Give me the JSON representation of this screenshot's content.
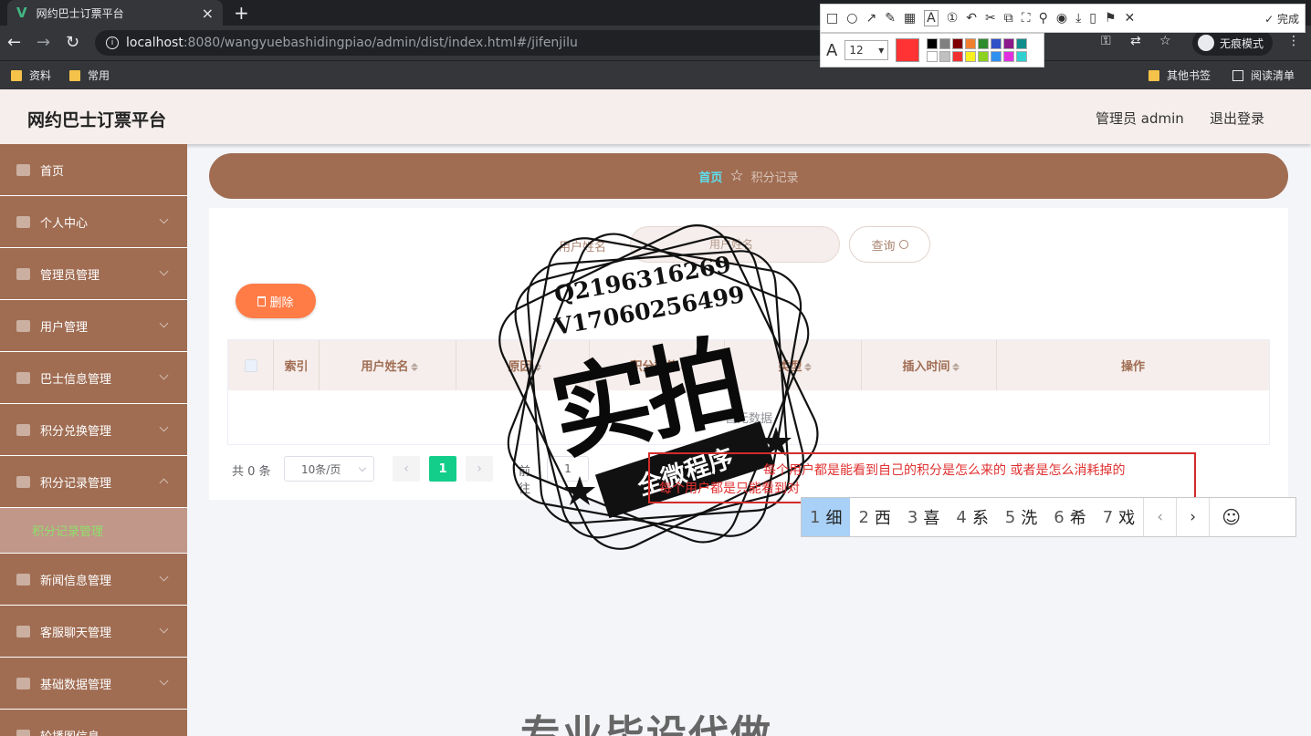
{
  "browser": {
    "tab_title": "网约巴士订票平台",
    "url_host": "localhost",
    "url_path": ":8080/wangyuebashidingpiao/admin/dist/index.html#/jifenjilu",
    "incognito_label": "无痕模式",
    "bookmarks": [
      "资料",
      "常用"
    ],
    "bookmarks_right": [
      "其他书签",
      "阅读清单"
    ]
  },
  "screenshot_tool": {
    "done_label": "完成",
    "font_size": "12",
    "current_color": "#ff3333"
  },
  "header": {
    "title": "网约巴士订票平台",
    "user": "管理员 admin",
    "logout": "退出登录"
  },
  "sidebar": {
    "items": [
      {
        "label": "首页"
      },
      {
        "label": "个人中心"
      },
      {
        "label": "管理员管理"
      },
      {
        "label": "用户管理"
      },
      {
        "label": "巴士信息管理"
      },
      {
        "label": "积分兑换管理"
      },
      {
        "label": "积分记录管理"
      },
      {
        "label": "新闻信息管理"
      },
      {
        "label": "客服聊天管理"
      },
      {
        "label": "基础数据管理"
      },
      {
        "label": "轮播图信息"
      }
    ],
    "sub_item": "积分记录管理"
  },
  "breadcrumb": {
    "home": "首页",
    "current": "积分记录"
  },
  "search": {
    "label": "用户姓名",
    "placeholder": "用户姓名",
    "query_button": "查询"
  },
  "actions": {
    "delete_button": "删除"
  },
  "table": {
    "columns": [
      "索引",
      "用户姓名",
      "原因",
      "积分数值",
      "类型",
      "插入时间",
      "操作"
    ],
    "empty_text": "暂无数据"
  },
  "pagination": {
    "total": "共 0 条",
    "page_size": "10条/页",
    "current_page": "1",
    "goto_label": "前往",
    "goto_value": "1"
  },
  "annotation": {
    "line1": "每个用户都是能看到自己的积分是怎么来的 或者是怎么消耗掉的",
    "line2": "每个用户都是只能看到对"
  },
  "ime": {
    "candidates": [
      {
        "n": "1",
        "c": "细"
      },
      {
        "n": "2",
        "c": "西"
      },
      {
        "n": "3",
        "c": "喜"
      },
      {
        "n": "4",
        "c": "系"
      },
      {
        "n": "5",
        "c": "洗"
      },
      {
        "n": "6",
        "c": "希"
      },
      {
        "n": "7",
        "c": "戏"
      }
    ]
  },
  "watermark": {
    "qq": "Q2196316269",
    "v": "V17060256499",
    "big": "实拍",
    "banner": "全微程序",
    "bottom": "专业毕设代做"
  }
}
